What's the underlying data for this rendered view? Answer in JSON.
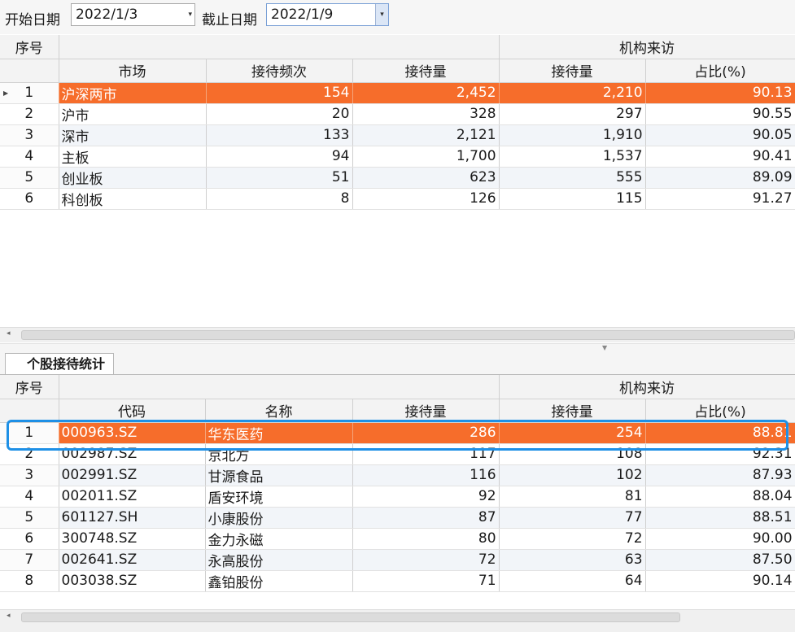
{
  "toolbar": {
    "start_label": "开始日期",
    "start_value": "2022/1/3",
    "end_label": "截止日期",
    "end_value": "2022/1/9",
    "dropdown_glyph": "▾"
  },
  "market_table": {
    "group_seq": "序号",
    "group_visit": "机构来访",
    "columns": [
      "市场",
      "接待频次",
      "接待量",
      "接待量",
      "占比(%)"
    ],
    "rows": [
      {
        "idx": "1",
        "market": "沪深两市",
        "freq": "154",
        "total": "2,452",
        "inst": "2,210",
        "ratio": "90.13"
      },
      {
        "idx": "2",
        "market": "沪市",
        "freq": "20",
        "total": "328",
        "inst": "297",
        "ratio": "90.55"
      },
      {
        "idx": "3",
        "market": "深市",
        "freq": "133",
        "total": "2,121",
        "inst": "1,910",
        "ratio": "90.05"
      },
      {
        "idx": "4",
        "market": "主板",
        "freq": "94",
        "total": "1,700",
        "inst": "1,537",
        "ratio": "90.41"
      },
      {
        "idx": "5",
        "market": "创业板",
        "freq": "51",
        "total": "623",
        "inst": "555",
        "ratio": "89.09"
      },
      {
        "idx": "6",
        "market": "科创板",
        "freq": "8",
        "total": "126",
        "inst": "115",
        "ratio": "91.27"
      }
    ]
  },
  "tab": {
    "label": "个股接待统计"
  },
  "stock_table": {
    "group_seq": "序号",
    "group_visit": "机构来访",
    "columns": [
      "代码",
      "名称",
      "接待量",
      "接待量",
      "占比(%)"
    ],
    "rows": [
      {
        "idx": "1",
        "code": "000963.SZ",
        "name": "华东医药",
        "total": "286",
        "inst": "254",
        "ratio": "88.81"
      },
      {
        "idx": "2",
        "code": "002987.SZ",
        "name": "京北方",
        "total": "117",
        "inst": "108",
        "ratio": "92.31"
      },
      {
        "idx": "3",
        "code": "002991.SZ",
        "name": "甘源食品",
        "total": "116",
        "inst": "102",
        "ratio": "87.93"
      },
      {
        "idx": "4",
        "code": "002011.SZ",
        "name": "盾安环境",
        "total": "92",
        "inst": "81",
        "ratio": "88.04"
      },
      {
        "idx": "5",
        "code": "601127.SH",
        "name": "小康股份",
        "total": "87",
        "inst": "77",
        "ratio": "88.51"
      },
      {
        "idx": "6",
        "code": "300748.SZ",
        "name": "金力永磁",
        "total": "80",
        "inst": "72",
        "ratio": "90.00"
      },
      {
        "idx": "7",
        "code": "002641.SZ",
        "name": "永高股份",
        "total": "72",
        "inst": "63",
        "ratio": "87.50"
      },
      {
        "idx": "8",
        "code": "003038.SZ",
        "name": "鑫铂股份",
        "total": "71",
        "inst": "64",
        "ratio": "90.14"
      }
    ]
  },
  "colors": {
    "selected_row": "#f66d2b",
    "highlight_border": "#1e90e6",
    "alt_row": "#f2f5f9"
  }
}
